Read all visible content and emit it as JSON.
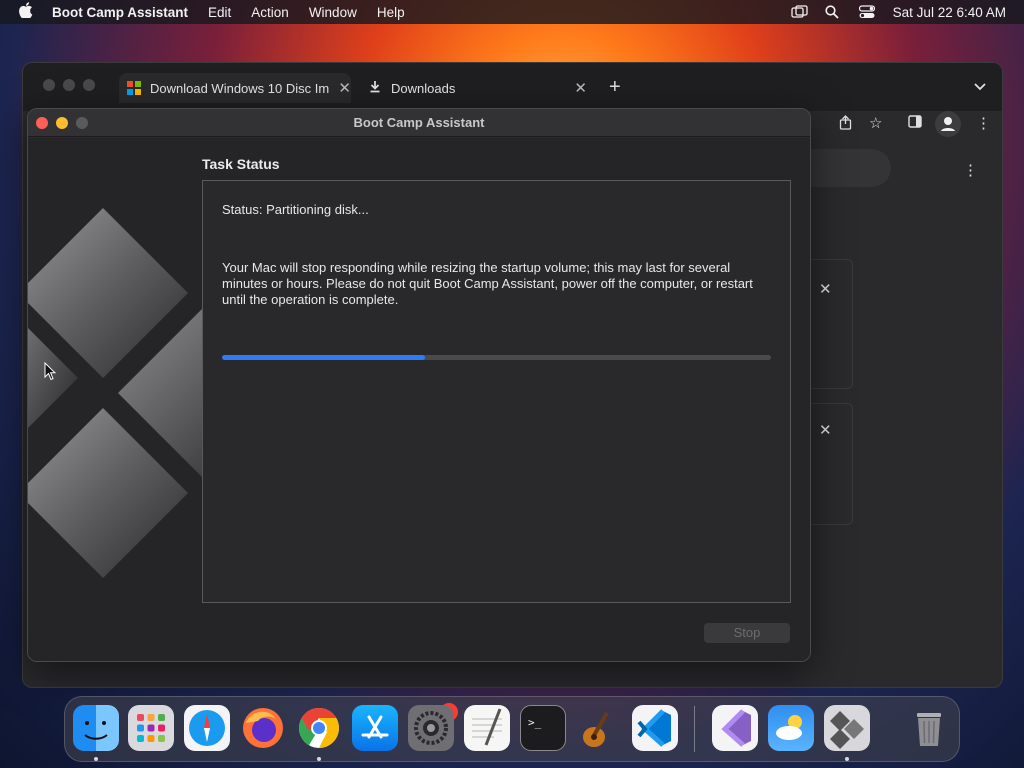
{
  "menubar": {
    "app_name": "Boot Camp Assistant",
    "menus": [
      "Edit",
      "Action",
      "Window",
      "Help"
    ],
    "clock": "Sat Jul 22  6:40 AM"
  },
  "browser": {
    "tabs": [
      {
        "title": "Download Windows 10 Disc Im",
        "icon": "windows-logo-icon"
      },
      {
        "title": "Downloads",
        "icon": "download-icon"
      }
    ]
  },
  "dialog": {
    "window_title": "Boot Camp Assistant",
    "heading": "Task Status",
    "status": "Status: Partitioning disk...",
    "message": "Your Mac will stop responding while resizing the startup volume; this may last for several minutes or hours. Please do not quit Boot Camp Assistant, power off the computer, or restart until the operation is complete.",
    "progress_fraction": 0.37,
    "stop_label": "Stop"
  },
  "dock": {
    "apps": [
      "Finder",
      "Launchpad",
      "Safari",
      "Firefox",
      "Google Chrome",
      "App Store",
      "System Settings",
      "TextEdit",
      "Terminal",
      "GarageBand",
      "Visual Studio Code",
      "Visual Studio",
      "Weather",
      "Boot Camp Assistant",
      "Trash"
    ],
    "badge": "1"
  },
  "colors": {
    "accent": "#2f7bf5",
    "close": "#ff5f57",
    "minimize": "#febc2e"
  }
}
